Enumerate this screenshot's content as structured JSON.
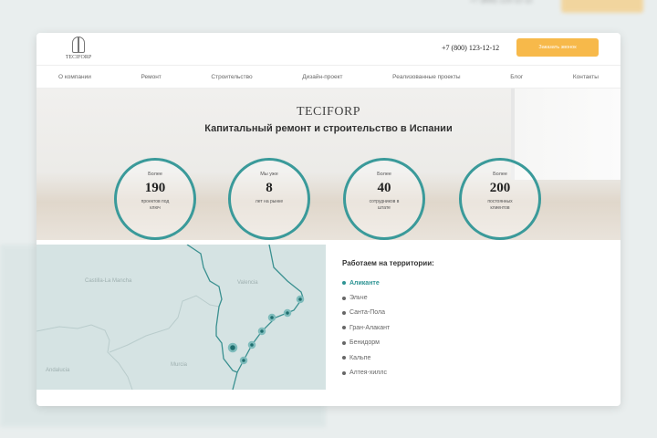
{
  "header": {
    "logo_text": "TECIFORP",
    "phone": "+7 (800) 123-12-12",
    "cta_label": "Заказать звонок"
  },
  "nav": [
    "О компании",
    "Ремонт",
    "Строительство",
    "Дизайн-проект",
    "Реализованные проекты",
    "Блог",
    "Контакты"
  ],
  "hero": {
    "brand": "TECIFORP",
    "title": "Капитальный ремонт и строительство в Испании",
    "stats": [
      {
        "pre": "Более",
        "num": "190",
        "sub": "проектов под ключ"
      },
      {
        "pre": "Мы уже",
        "num": "8",
        "sub": "лет на рынке"
      },
      {
        "pre": "Более",
        "num": "40",
        "sub": "сотрудников в штате"
      },
      {
        "pre": "Более",
        "num": "200",
        "sub": "постоянных клиентов"
      }
    ]
  },
  "map": {
    "regions": [
      "Castilla-La Mancha",
      "Valencia",
      "Andalucia",
      "Murcia"
    ]
  },
  "territory": {
    "title": "Работаем на территории:",
    "items": [
      "Аликанте",
      "Эльче",
      "Санта-Пола",
      "Гран-Алакант",
      "Бенидорм",
      "Кальпе",
      "Алтея-хиллс"
    ],
    "active": 0
  },
  "colors": {
    "accent": "#3a9a9a",
    "cta": "#f7b94a"
  }
}
